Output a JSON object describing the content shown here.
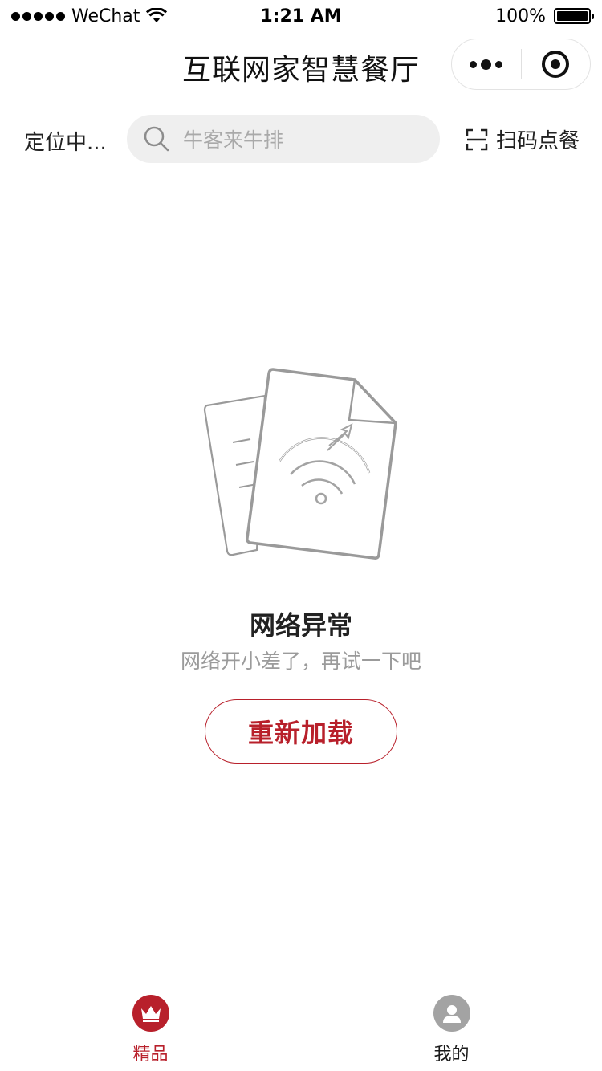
{
  "status_bar": {
    "carrier": "WeChat",
    "time": "1:21 AM",
    "battery": "100%",
    "battery_level": 1.0
  },
  "nav": {
    "title": "互联网家智慧餐厅",
    "more_icon": "more-dots-icon",
    "close_icon": "target-icon"
  },
  "search_row": {
    "location": "定位中...",
    "search_placeholder": "牛客来牛排",
    "scan_label": "扫码点餐",
    "search_icon": "search-icon",
    "scan_icon": "scan-icon"
  },
  "error_state": {
    "title": "网络异常",
    "description": "网络开小差了，再试一下吧",
    "reload_label": "重新加载",
    "illustration_icon": "no-network-document-icon"
  },
  "tab_bar": {
    "items": [
      {
        "label": "精品",
        "icon": "crown-icon",
        "active": true
      },
      {
        "label": "我的",
        "icon": "user-icon",
        "active": false
      }
    ]
  },
  "colors": {
    "accent": "#b8202b",
    "search_bg": "#efefef",
    "muted_text": "#9b9b9b",
    "inactive_icon": "#a3a3a3"
  }
}
